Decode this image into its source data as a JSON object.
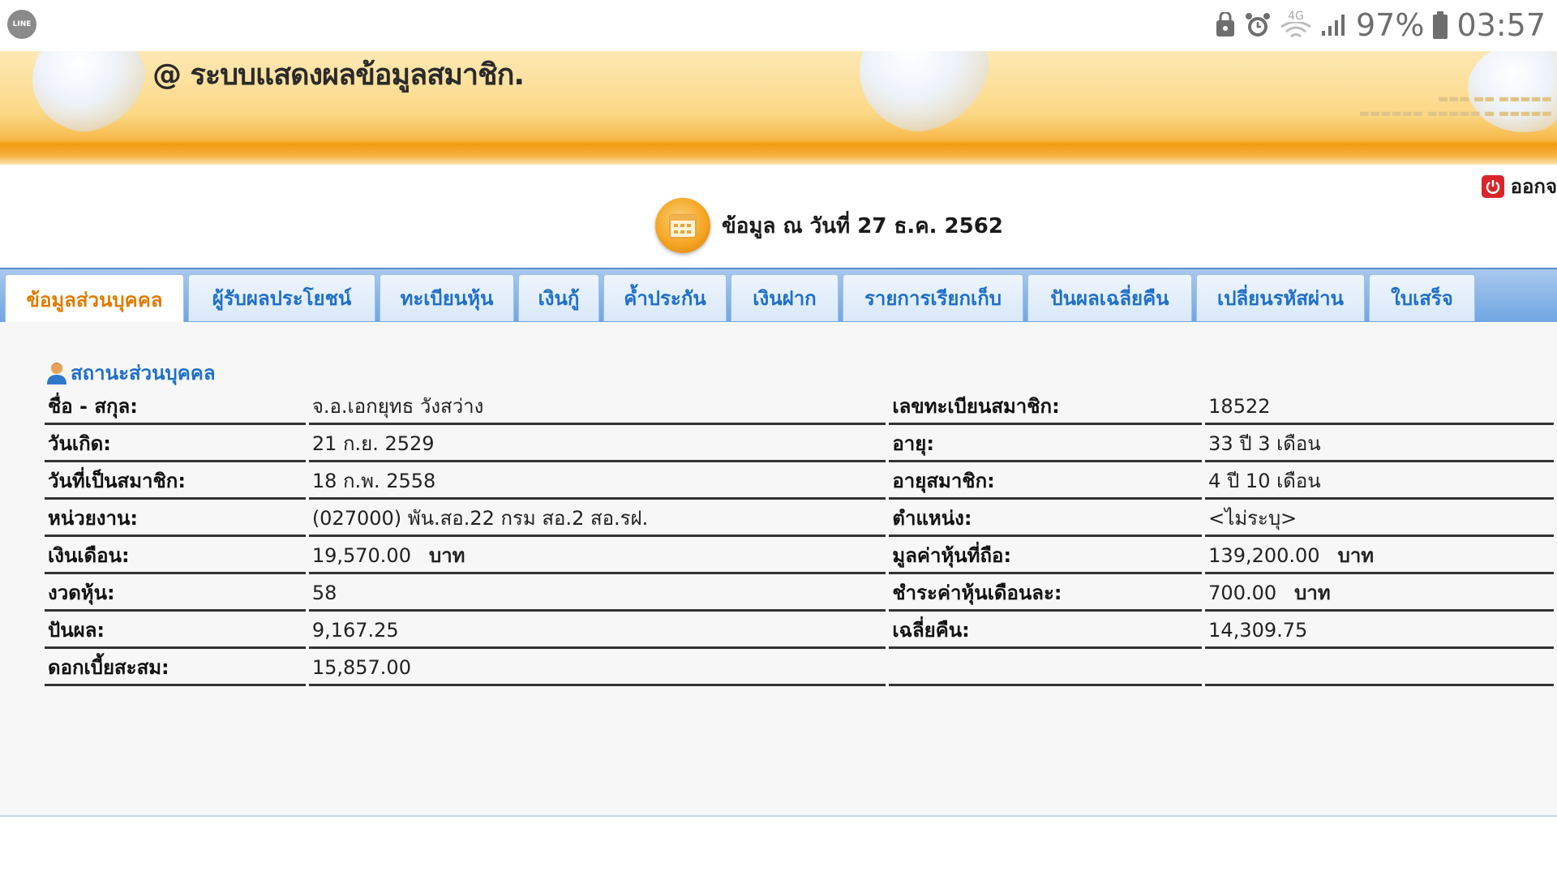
{
  "status_bar": {
    "app_icon": "line-icon",
    "app_label": "LINE",
    "network": "4G",
    "battery": "97%",
    "time": "03:57"
  },
  "banner": {
    "title": "@ ระบบแสดงผลข้อมูลสมาชิก."
  },
  "logout_label": "ออกจ",
  "date_line": "ข้อมูล ณ วันที่ 27 ธ.ค. 2562",
  "tabs": [
    {
      "label": "ข้อมูลส่วนบุคคล",
      "active": true
    },
    {
      "label": "ผู้รับผลประโยชน์",
      "active": false
    },
    {
      "label": "ทะเบียนหุ้น",
      "active": false
    },
    {
      "label": "เงินกู้",
      "active": false
    },
    {
      "label": "ค้ำประกัน",
      "active": false
    },
    {
      "label": "เงินฝาก",
      "active": false
    },
    {
      "label": "รายการเรียกเก็บ",
      "active": false
    },
    {
      "label": "ปันผลเฉลี่ยคืน",
      "active": false
    },
    {
      "label": "เปลี่ยนรหัสผ่าน",
      "active": false
    },
    {
      "label": "ใบเสร็จ",
      "active": false
    }
  ],
  "section_title": "สถานะส่วนบุคคล",
  "rows": [
    {
      "l1": "ชื่อ - สกุล:",
      "v1": "จ.อ.เอกยุทธ    วังสว่าง",
      "u1": "",
      "l2": "เลขทะเบียนสมาชิก:",
      "v2": "18522",
      "u2": ""
    },
    {
      "l1": "วันเกิด:",
      "v1": "21 ก.ย. 2529",
      "u1": "",
      "l2": "อายุ:",
      "v2": "33  ปี 3 เดือน",
      "u2": ""
    },
    {
      "l1": "วันที่เป็นสมาชิก:",
      "v1": "18 ก.พ. 2558",
      "u1": "",
      "l2": "อายุสมาชิก:",
      "v2": "4  ปี 10 เดือน",
      "u2": ""
    },
    {
      "l1": "หน่วยงาน:",
      "v1": "(027000) พัน.สอ.22 กรม สอ.2 สอ.รฝ.",
      "u1": "",
      "l2": "ตำแหน่ง:",
      "v2": "<ไม่ระบุ>",
      "u2": ""
    },
    {
      "l1": "เงินเดือน:",
      "v1": "19,570.00",
      "u1": "บาท",
      "l2": "มูลค่าหุ้นที่ถือ:",
      "v2": "139,200.00",
      "u2": "บาท"
    },
    {
      "l1": "งวดหุ้น:",
      "v1": "58",
      "u1": "",
      "l2": "ชำระค่าหุ้นเดือนละ:",
      "v2": "700.00",
      "u2": "บาท"
    },
    {
      "l1": "ปันผล:",
      "v1": "9,167.25",
      "u1": "",
      "l2": "เฉลี่ยคืน:",
      "v2": "14,309.75",
      "u2": ""
    },
    {
      "l1": "ดอกเบี้ยสะสม:",
      "v1": "15,857.00",
      "u1": "",
      "l2": "",
      "v2": "",
      "u2": ""
    }
  ]
}
